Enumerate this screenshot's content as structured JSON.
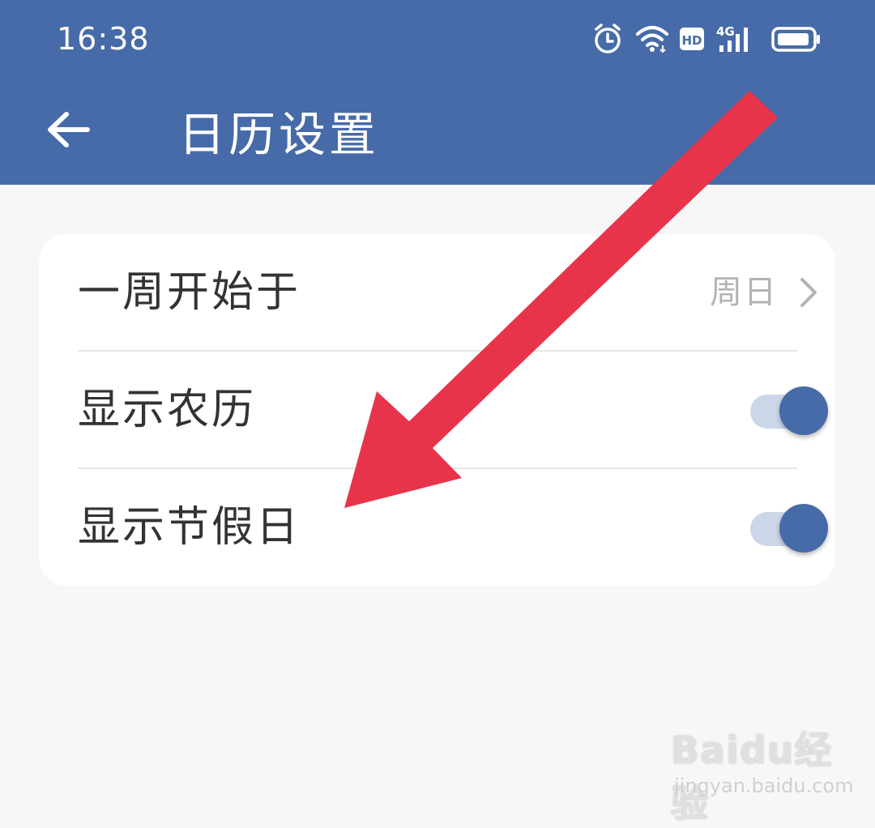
{
  "status_bar": {
    "time": "16:38",
    "icons": [
      "alarm-icon",
      "wifi-icon",
      "hd-icon",
      "4g-signal-icon",
      "battery-icon"
    ],
    "hd_label": "HD",
    "network_label": "4G"
  },
  "header": {
    "title": "日历设置",
    "back_icon": "back-arrow-icon"
  },
  "settings": {
    "week_start": {
      "label": "一周开始于",
      "value": "周日"
    },
    "show_lunar": {
      "label": "显示农历",
      "enabled": true
    },
    "show_holidays": {
      "label": "显示节假日",
      "enabled": true
    }
  },
  "watermark": {
    "brand": "Baidu经验",
    "url": "jingyan.baidu.com"
  },
  "colors": {
    "primary": "#476ba8",
    "background": "#f7f7f7",
    "card": "#ffffff",
    "annotation_arrow": "#e8344a",
    "toggle_track": "#cbd6e8"
  }
}
